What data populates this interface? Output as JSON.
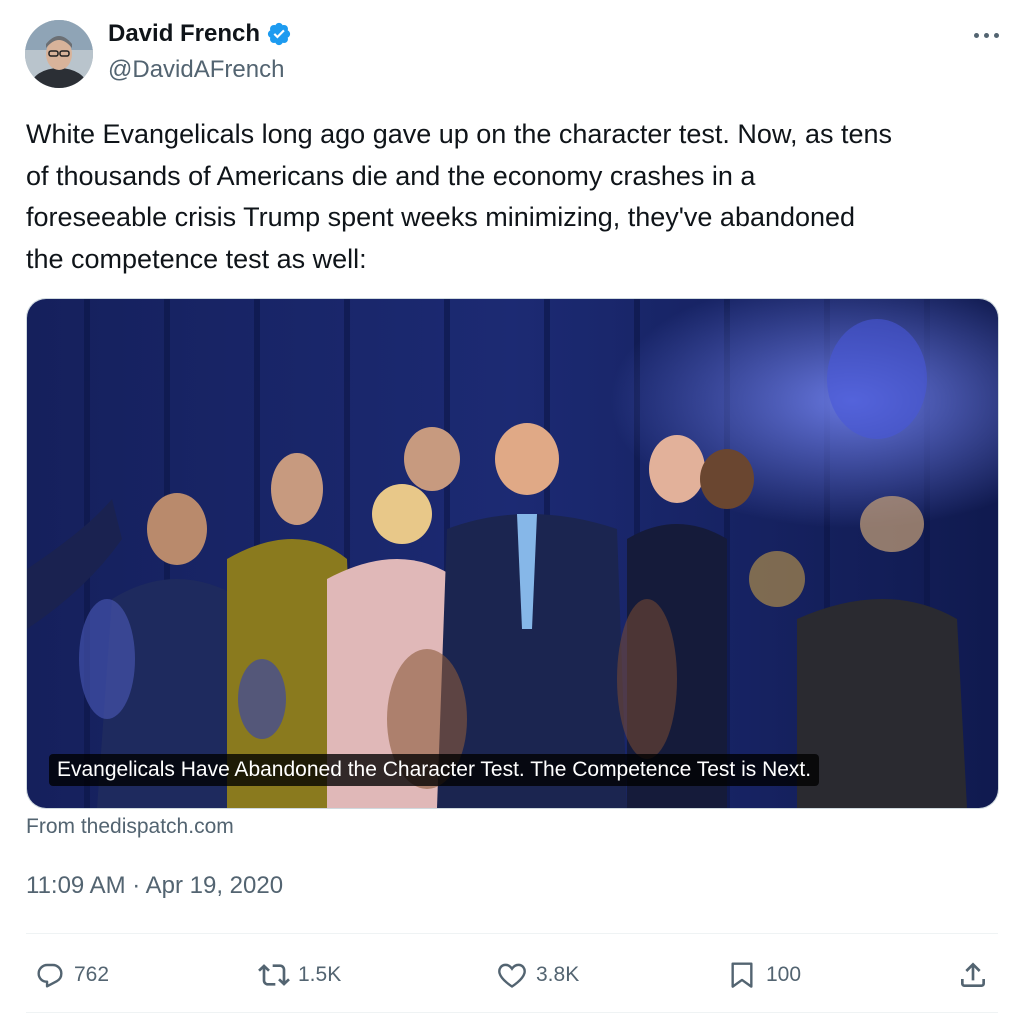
{
  "author": {
    "name": "David French",
    "handle": "@DavidAFrench",
    "verified_color": "#1d9bf0"
  },
  "tweet": {
    "text": "White Evangelicals long ago gave up on the character test. Now, as tens\nof thousands of Americans die and the economy crashes in a\nforeseeable crisis Trump spent weeks minimizing, they've abandoned\nthe competence test as well:",
    "timestamp": "11:09 AM · Apr 19, 2020"
  },
  "link_card": {
    "caption": "Evangelicals Have Abandoned the Character Test. The Competence Test is Next.",
    "source": "From thedispatch.com"
  },
  "actions": {
    "replies": "762",
    "reposts": "1.5K",
    "likes": "3.8K",
    "bookmarks": "100"
  },
  "icons": {
    "reply": "reply-icon",
    "repost": "repost-icon",
    "like": "heart-icon",
    "bookmark": "bookmark-icon",
    "share": "share-icon",
    "more": "more-icon",
    "verified": "verified-badge-icon"
  },
  "colors": {
    "text": "#0f1419",
    "secondary": "#536471",
    "accent": "#1d9bf0"
  }
}
